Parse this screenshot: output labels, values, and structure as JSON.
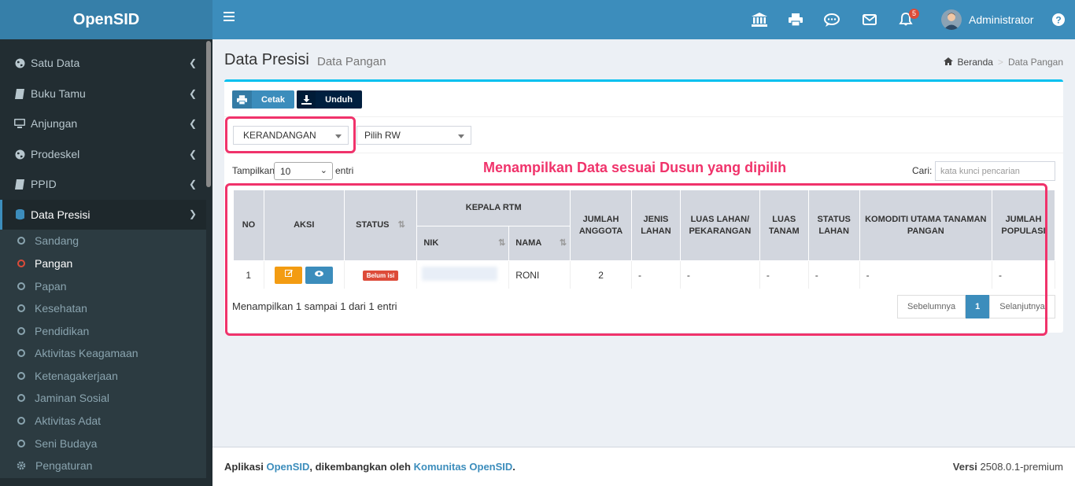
{
  "brand": "OpenSID",
  "header": {
    "notification_count": "5",
    "user_name": "Administrator"
  },
  "sidebar": {
    "items": [
      {
        "label": "Satu Data",
        "icon": "globe-icon"
      },
      {
        "label": "Buku Tamu",
        "icon": "book-icon"
      },
      {
        "label": "Anjungan",
        "icon": "monitor-icon"
      },
      {
        "label": "Prodeskel",
        "icon": "globe-icon"
      },
      {
        "label": "PPID",
        "icon": "book-icon"
      },
      {
        "label": "Data Presisi",
        "icon": "database-icon",
        "active": true
      }
    ],
    "sub_items": [
      "Sandang",
      "Pangan",
      "Papan",
      "Kesehatan",
      "Pendidikan",
      "Aktivitas Keagamaan",
      "Ketenagakerjaan",
      "Jaminan Sosial",
      "Aktivitas Adat",
      "Seni Budaya"
    ],
    "current_sub": "Pangan",
    "settings_label": "Pengaturan"
  },
  "page": {
    "title": "Data Presisi",
    "subtitle": "Data Pangan",
    "breadcrumb_home": "Beranda",
    "breadcrumb_current": "Data Pangan"
  },
  "toolbar": {
    "print_label": "Cetak",
    "download_label": "Unduh"
  },
  "filters": {
    "dusun_value": "KERANDANGAN",
    "rw_placeholder": "Pilih RW"
  },
  "annotation": "Menampilkan Data sesuai Dusun yang dipilih",
  "table_controls": {
    "show_label": "Tampilkan",
    "page_length": "10",
    "entries_label": "entri",
    "search_label": "Cari:",
    "search_placeholder": "kata kunci pencarian"
  },
  "table": {
    "headers": {
      "no": "NO",
      "aksi": "AKSI",
      "status": "STATUS",
      "kepala_rtm": "KEPALA RTM",
      "nik": "NIK",
      "nama": "NAMA",
      "jumlah_anggota": "JUMLAH ANGGOTA",
      "jenis_lahan": "JENIS LAHAN",
      "luas_lahan": "LUAS LAHAN/ PEKARANGAN",
      "luas_tanam": "LUAS TANAM",
      "status_lahan": "STATUS LAHAN",
      "komoditi": "KOMODITI UTAMA TANAMAN PANGAN",
      "jumlah_populasi": "JUMLAH POPULASI"
    },
    "rows": [
      {
        "no": "1",
        "status": "Belum isi",
        "nama": "RONI",
        "jumlah_anggota": "2",
        "jenis_lahan": "-",
        "luas_lahan": "-",
        "luas_tanam": "-",
        "status_lahan": "-",
        "komoditi": "-",
        "jumlah_populasi": "-"
      }
    ]
  },
  "pagination": {
    "info": "Menampilkan 1 sampai 1 dari 1 entri",
    "prev": "Sebelumnya",
    "current": "1",
    "next": "Selanjutnya"
  },
  "footer": {
    "prefix": "Aplikasi",
    "app_link": "OpenSID",
    "middle": ", dikembangkan oleh",
    "community_link": "Komunitas OpenSID",
    "suffix": ".",
    "version_label": "Versi",
    "version": "2508.0.1-premium"
  },
  "colors": {
    "header": "#3c8dbc",
    "brand": "#367fa9",
    "sidebar": "#222d32",
    "highlight": "#f0336b",
    "box_top": "#00c0ef"
  }
}
